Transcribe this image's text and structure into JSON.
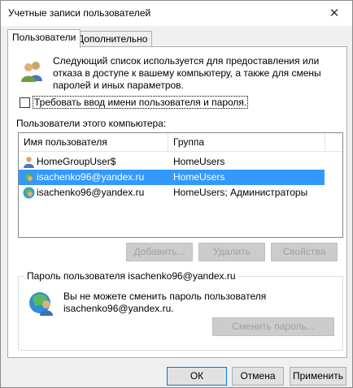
{
  "window": {
    "title": "Учетные записи пользователей",
    "close_glyph": "✕"
  },
  "tabs": [
    {
      "label": "Пользователи",
      "active": true
    },
    {
      "label": "Дополнительно",
      "active": false
    }
  ],
  "info": {
    "text": "Следующий список используется для предоставления или отказа в доступе к вашему компьютеру, а также для смены паролей и иных параметров.",
    "icon": "users-icon"
  },
  "require_login": {
    "label": "Требовать ввод имени пользователя и пароля.",
    "checked": false
  },
  "users_section": {
    "label": "Пользователи этого компьютера:"
  },
  "list": {
    "columns": [
      "Имя пользователя",
      "Группа"
    ],
    "rows": [
      {
        "name": "HomeGroupUser$",
        "group": "HomeUsers",
        "selected": false
      },
      {
        "name": "isachenko96@yandex.ru",
        "group": "HomeUsers",
        "selected": true
      },
      {
        "name": "isachenko96@yandex.ru",
        "group": "HomeUsers; Администраторы",
        "selected": false
      }
    ]
  },
  "list_buttons": {
    "add": "Добавить...",
    "remove": "Удалить",
    "properties": "Свойства"
  },
  "password_group": {
    "title": "Пароль пользователя isachenko96@yandex.ru",
    "text": "Вы не можете сменить пароль пользователя isachenko96@yandex.ru.",
    "change_button": "Сменить пароль..."
  },
  "dialog_buttons": {
    "ok": "ОК",
    "cancel": "Отмена",
    "apply": "Применить"
  },
  "colors": {
    "selection": "#3399ff",
    "panel": "#ffffff",
    "window": "#f0f0f0"
  }
}
